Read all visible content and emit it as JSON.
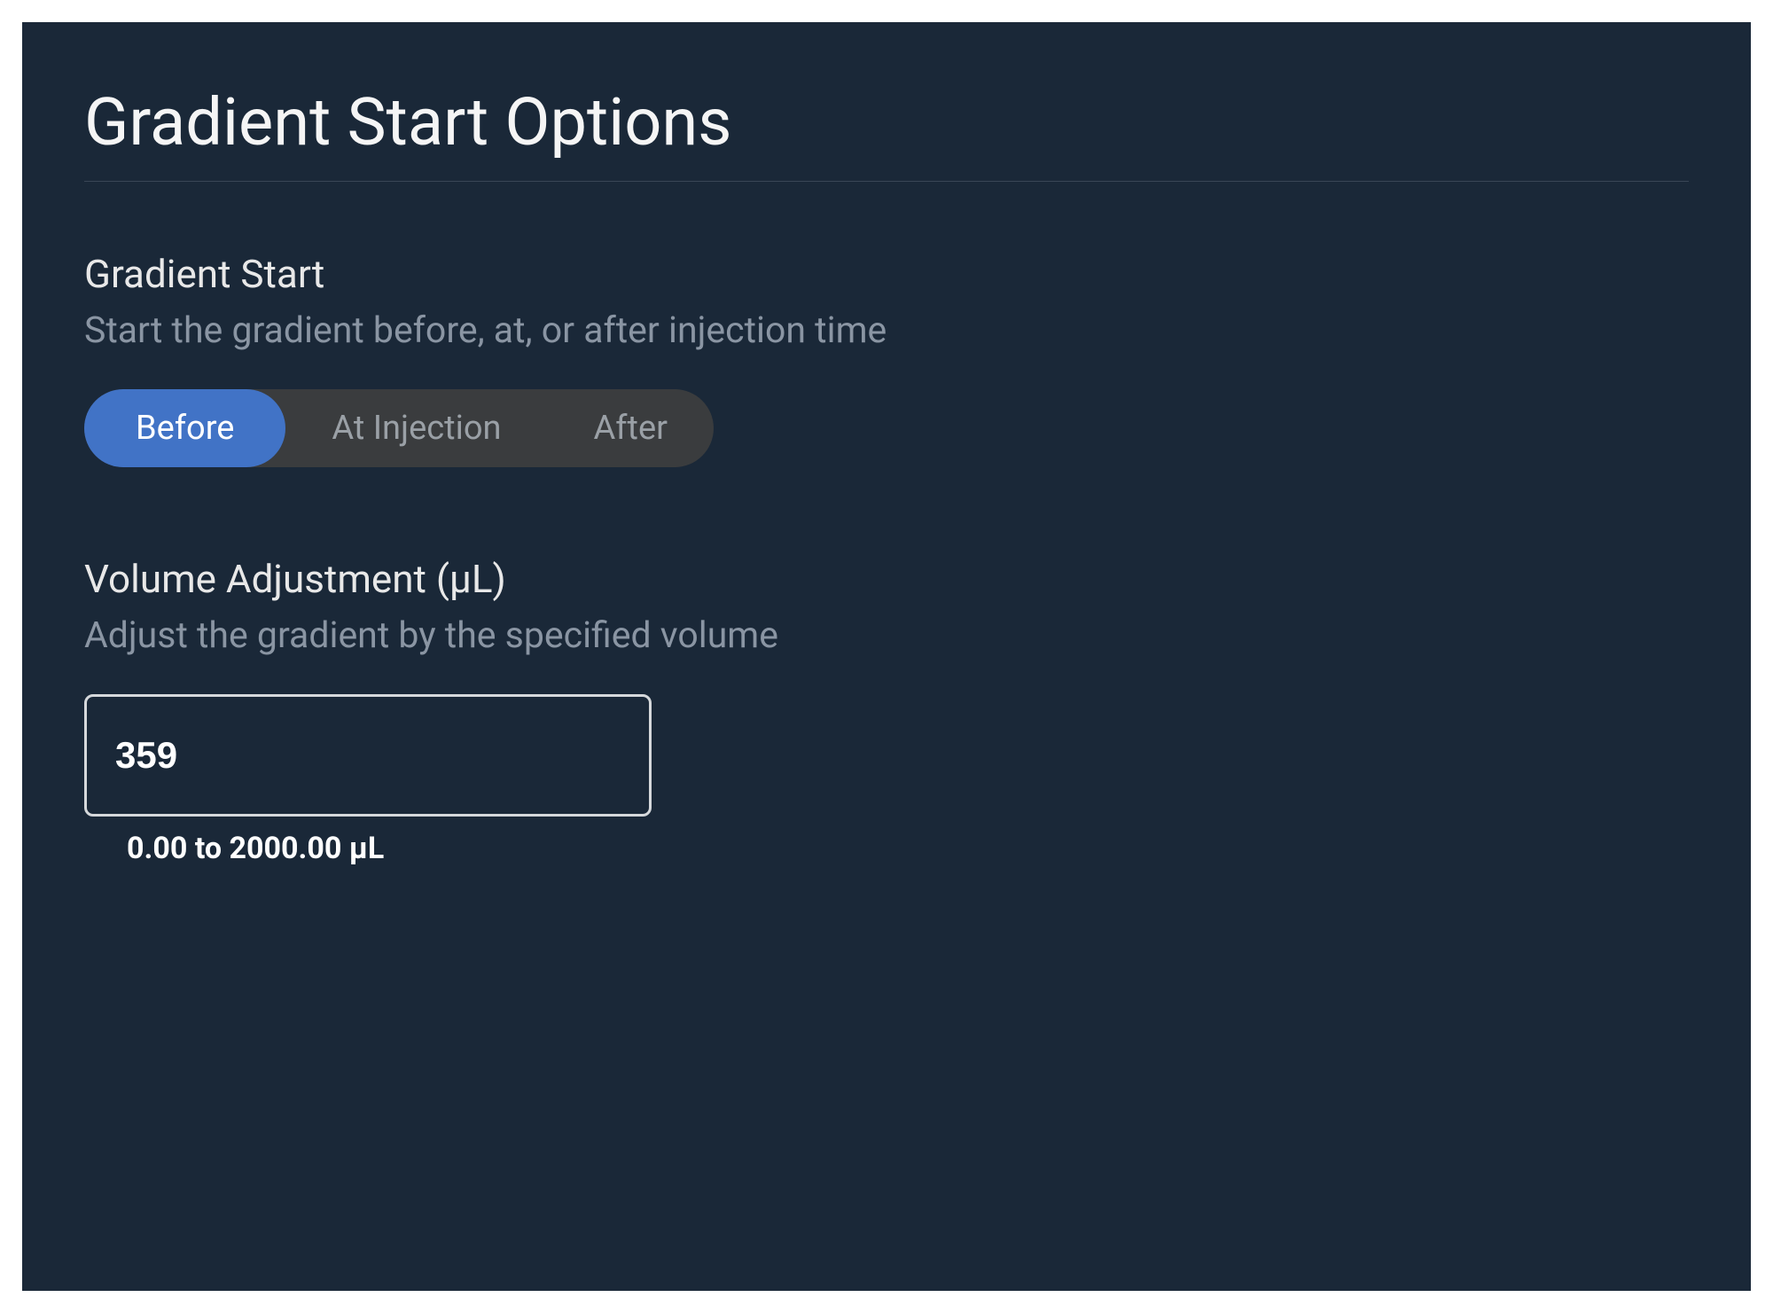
{
  "title": "Gradient Start Options",
  "sections": {
    "gradientStart": {
      "label": "Gradient Start",
      "description": "Start the gradient before, at, or after injection time",
      "options": [
        "Before",
        "At Injection",
        "After"
      ],
      "selected": 0
    },
    "volumeAdjustment": {
      "label": "Volume Adjustment (µL)",
      "description": "Adjust the gradient by the specified volume",
      "value": "359",
      "hint": "0.00 to 2000.00 µL",
      "min": 0.0,
      "max": 2000.0
    }
  },
  "colors": {
    "panelBg": "#1a2838",
    "accent": "#4173c6",
    "segmentBg": "#3a3c3e",
    "textPrimary": "#f5f5f5",
    "textMuted": "#8a95a3"
  }
}
